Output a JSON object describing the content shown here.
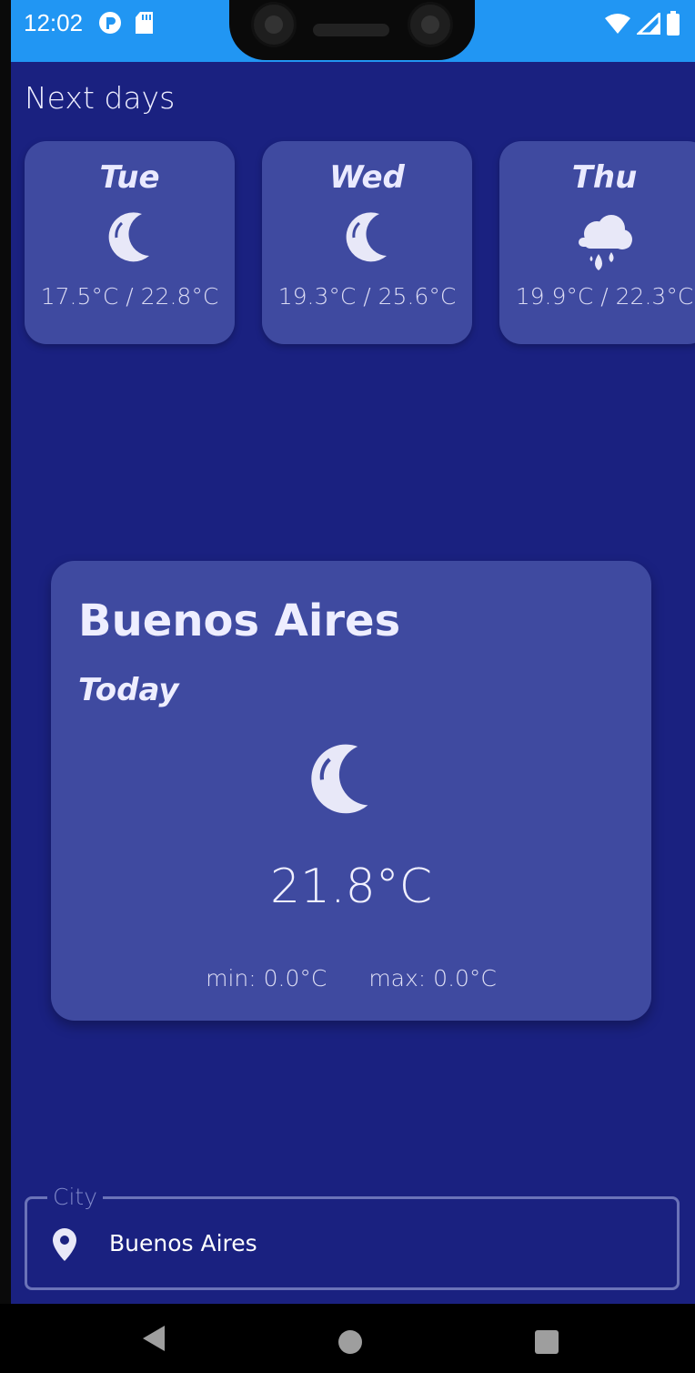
{
  "status_bar": {
    "time": "12:02",
    "color": "#2196f3"
  },
  "next_days": {
    "title": "Next days",
    "days": [
      {
        "name": "Tue",
        "icon": "moon-icon",
        "temps": "17.5°C / 22.8°C"
      },
      {
        "name": "Wed",
        "icon": "moon-icon",
        "temps": "19.3°C / 25.6°C"
      },
      {
        "name": "Thu",
        "icon": "cloud-rain-icon",
        "temps": "19.9°C / 22.3°C"
      }
    ]
  },
  "today": {
    "city": "Buenos Aires",
    "label": "Today",
    "icon": "moon-icon",
    "temperature": "21.8°C",
    "min": "min: 0.0°C",
    "max": "max: 0.0°C"
  },
  "city_field": {
    "label": "City",
    "value": "Buenos Aires",
    "icon": "location-pin-icon"
  },
  "colors": {
    "background": "#1a2180",
    "card": "#3f4aa0",
    "text": "#e8e8f8"
  }
}
